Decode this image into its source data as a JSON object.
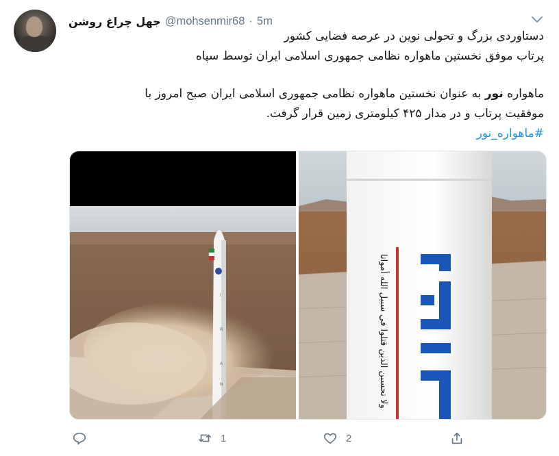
{
  "tweet": {
    "author_name": "جهل چراغ روشن",
    "author_handle": "@mohsenmir68",
    "separator": "·",
    "time": "5m",
    "lines": [
      "دستاوردی بزرگ و تحولی نوین در عرصه فضایی کشور",
      "پرتاب موفق نخستین ماهواره نظامی جمهوری اسلامی ایران توسط سپاه",
      "به عنوان نخستین ماهواره نظامی جمهوری اسلامی ایران صبح امروز با",
      "موفقیت پرتاب و در مدار ۴۲۵ کیلومتری زمین قرار گرفت.",
      "#ماهواره_نور"
    ],
    "line3_prefix": "ماهواره",
    "line3_bold": "نور",
    "media": [
      {
        "label": "rocket-launch-photo"
      },
      {
        "label": "rocket-closeup-photo",
        "rocket_text": "ولا تحسبن الذين قتلوا في سبيل الله أمواتا"
      }
    ]
  },
  "actions": {
    "reply_count": "",
    "retweet_count": "1",
    "like_count": "2",
    "share_count": ""
  },
  "colors": {
    "link": "#1b95e0",
    "muted": "#657786",
    "text": "#14171a"
  },
  "icons": [
    "chevron-down-icon",
    "reply-icon",
    "retweet-icon",
    "like-icon",
    "share-icon"
  ]
}
